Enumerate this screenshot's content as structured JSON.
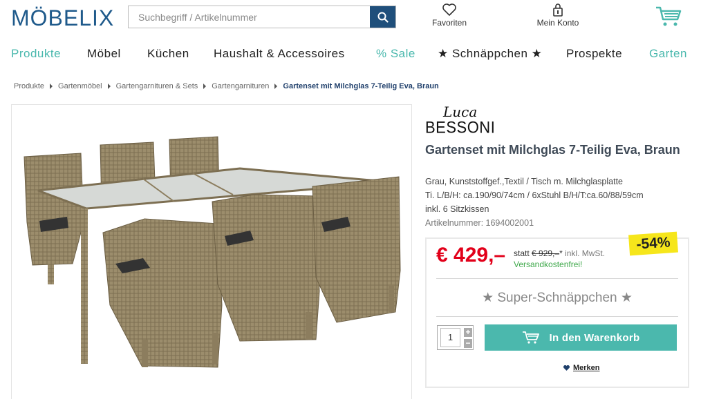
{
  "header": {
    "logo": "MÖBELIX",
    "search_placeholder": "Suchbegriff / Artikelnummer",
    "favorites_label": "Favoriten",
    "account_label": "Mein Konto"
  },
  "nav": [
    {
      "label": "Produkte",
      "highlight": true
    },
    {
      "label": "Möbel",
      "highlight": false
    },
    {
      "label": "Küchen",
      "highlight": false
    },
    {
      "label": "Haushalt & Accessoires",
      "highlight": false
    },
    {
      "label": "% Sale",
      "highlight": true
    },
    {
      "label": "★ Schnäppchen ★",
      "highlight": false
    },
    {
      "label": "Prospekte",
      "highlight": false
    },
    {
      "label": "Garten",
      "highlight": true
    }
  ],
  "breadcrumb": [
    "Produkte",
    "Gartenmöbel",
    "Gartengarnituren & Sets",
    "Gartengarnituren",
    "Gartenset mit Milchglas 7-Teilig Eva, Braun"
  ],
  "product": {
    "brand_script": "Luca",
    "brand_name": "BESSONI",
    "title": "Gartenset mit Milchglas 7-Teilig Eva, Braun",
    "desc": [
      "Grau, Kunststoffgef.,Textil / Tisch m. Milchglasplatte",
      "Ti. L/B/H: ca.190/90/74cm / 6xStuhl B/H/T:ca.60/88/59cm",
      "inkl. 6 Sitzkissen"
    ],
    "article_number": "Artikelnummer: 1694002001",
    "image_alt": "Rattan garden set with glass table and six armchairs"
  },
  "price": {
    "current": "€ 429,–",
    "statt_label": "statt",
    "old": "€ 929,–",
    "asterisk": "*",
    "mwst": "inkl. MwSt.",
    "shipping": "Versandkostenfrei!",
    "discount": "-54%",
    "super": "★ Super-Schnäppchen ★",
    "quantity": "1",
    "add_to_cart": "In den Warenkorb",
    "plus": "+",
    "minus": "−",
    "merken": "Merken"
  },
  "colors": {
    "brand_blue": "#1f5a8b",
    "teal": "#4bb8ad",
    "price_red": "#e2001a",
    "badge_yellow": "#f6e61b",
    "shipping_green": "#3ea84a"
  }
}
